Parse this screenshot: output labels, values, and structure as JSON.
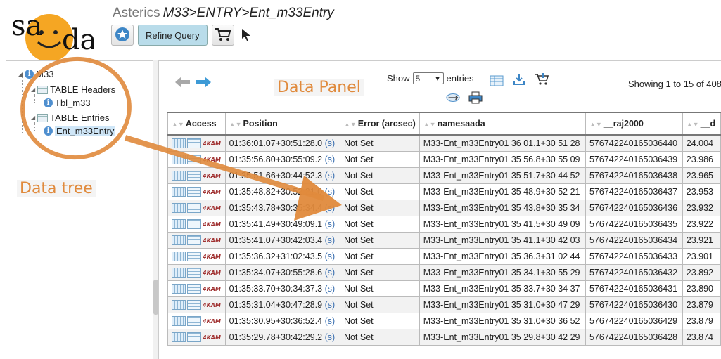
{
  "header": {
    "app_name": "Asterics",
    "path": "M33>ENTRY>Ent_m33Entry",
    "logo_text": "saada"
  },
  "toolbar": {
    "star_icon": "star-icon",
    "refine_label": "Refine Query",
    "cart_icon": "cart-icon",
    "cursor_icon": "cursor-icon"
  },
  "tree": {
    "root": "M33",
    "headers_label": "TABLE Headers",
    "headers_child": "Tbl_m33",
    "entries_label": "TABLE Entries",
    "entries_child": "Ent_m33Entry",
    "annotation": "Data tree"
  },
  "panel": {
    "annotation": "Data Panel",
    "show_label": "Show",
    "show_value": "5",
    "entries_label": "entries",
    "showing_text": "Showing 1 to 15 of 408"
  },
  "colors": {
    "accent": "#e08a3c",
    "refine_bg": "#b9dcea",
    "link": "#3a6fb0"
  },
  "table": {
    "columns": [
      "Access",
      "Position",
      "Error (arcsec)",
      "namesaada",
      "__raj2000",
      "__d"
    ],
    "rows": [
      {
        "position": "01:36:01.07+30:51:28.0",
        "s": "(s)",
        "error": "Not Set",
        "name": "M33-Ent_m33Entry01 36 01.1+30 51 28",
        "raj": "576742240165036440",
        "d": "24.004"
      },
      {
        "position": "01:35:56.80+30:55:09.2",
        "s": "(s)",
        "error": "Not Set",
        "name": "M33-Ent_m33Entry01 35 56.8+30 55 09",
        "raj": "576742240165036439",
        "d": "23.986"
      },
      {
        "position": "01:35:51.66+30:44:52.3",
        "s": "(s)",
        "error": "Not Set",
        "name": "M33-Ent_m33Entry01 35 51.7+30 44 52",
        "raj": "576742240165036438",
        "d": "23.965"
      },
      {
        "position": "01:35:48.82+30:52:21.0",
        "s": "(s)",
        "error": "Not Set",
        "name": "M33-Ent_m33Entry01 35 48.9+30 52 21",
        "raj": "576742240165036437",
        "d": "23.953"
      },
      {
        "position": "01:35:43.78+30:35:34.4",
        "s": "(s)",
        "error": "Not Set",
        "name": "M33-Ent_m33Entry01 35 43.8+30 35 34",
        "raj": "576742240165036436",
        "d": "23.932"
      },
      {
        "position": "01:35:41.49+30:49:09.1",
        "s": "(s)",
        "error": "Not Set",
        "name": "M33-Ent_m33Entry01 35 41.5+30 49 09",
        "raj": "576742240165036435",
        "d": "23.922"
      },
      {
        "position": "01:35:41.07+30:42:03.4",
        "s": "(s)",
        "error": "Not Set",
        "name": "M33-Ent_m33Entry01 35 41.1+30 42 03",
        "raj": "576742240165036434",
        "d": "23.921"
      },
      {
        "position": "01:35:36.32+31:02:43.5",
        "s": "(s)",
        "error": "Not Set",
        "name": "M33-Ent_m33Entry01 35 36.3+31 02 44",
        "raj": "576742240165036433",
        "d": "23.901"
      },
      {
        "position": "01:35:34.07+30:55:28.6",
        "s": "(s)",
        "error": "Not Set",
        "name": "M33-Ent_m33Entry01 35 34.1+30 55 29",
        "raj": "576742240165036432",
        "d": "23.892"
      },
      {
        "position": "01:35:33.70+30:34:37.3",
        "s": "(s)",
        "error": "Not Set",
        "name": "M33-Ent_m33Entry01 35 33.7+30 34 37",
        "raj": "576742240165036431",
        "d": "23.890"
      },
      {
        "position": "01:35:31.04+30:47:28.9",
        "s": "(s)",
        "error": "Not Set",
        "name": "M33-Ent_m33Entry01 35 31.0+30 47 29",
        "raj": "576742240165036430",
        "d": "23.879"
      },
      {
        "position": "01:35:30.95+30:36:52.4",
        "s": "(s)",
        "error": "Not Set",
        "name": "M33-Ent_m33Entry01 35 31.0+30 36 52",
        "raj": "576742240165036429",
        "d": "23.879"
      },
      {
        "position": "01:35:29.78+30:42:29.2",
        "s": "(s)",
        "error": "Not Set",
        "name": "M33-Ent_m33Entry01 35 29.8+30 42 29",
        "raj": "576742240165036428",
        "d": "23.874"
      }
    ]
  }
}
